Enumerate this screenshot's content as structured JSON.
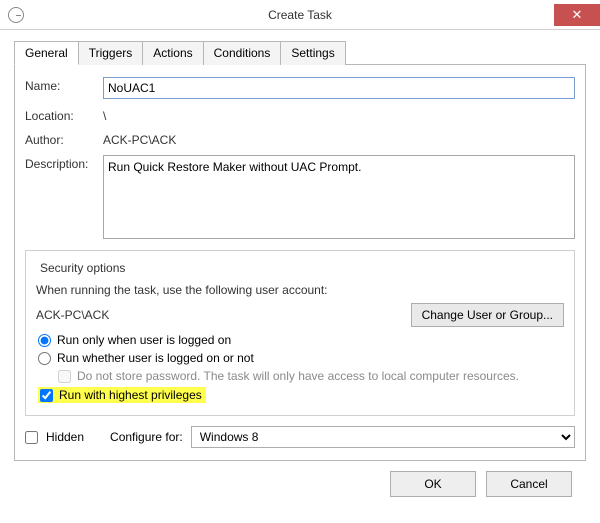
{
  "window": {
    "title": "Create Task"
  },
  "tabs": {
    "general": "General",
    "triggers": "Triggers",
    "actions": "Actions",
    "conditions": "Conditions",
    "settings": "Settings"
  },
  "fields": {
    "name_label": "Name:",
    "name_value": "NoUAC1",
    "location_label": "Location:",
    "location_value": "\\",
    "author_label": "Author:",
    "author_value": "ACK-PC\\ACK",
    "description_label": "Description:",
    "description_value": "Run Quick Restore Maker without UAC Prompt."
  },
  "security": {
    "legend": "Security options",
    "when_running": "When running the task, use the following user account:",
    "account": "ACK-PC\\ACK",
    "change_user_btn": "Change User or Group...",
    "run_logged_on": "Run only when user is logged on",
    "run_whether": "Run whether user is logged on or not",
    "no_store_pw": "Do not store password.  The task will only have access to local computer resources.",
    "highest_priv": "Run with highest privileges"
  },
  "bottom": {
    "hidden": "Hidden",
    "configure_for": "Configure for:",
    "configure_value": "Windows 8"
  },
  "buttons": {
    "ok": "OK",
    "cancel": "Cancel"
  }
}
